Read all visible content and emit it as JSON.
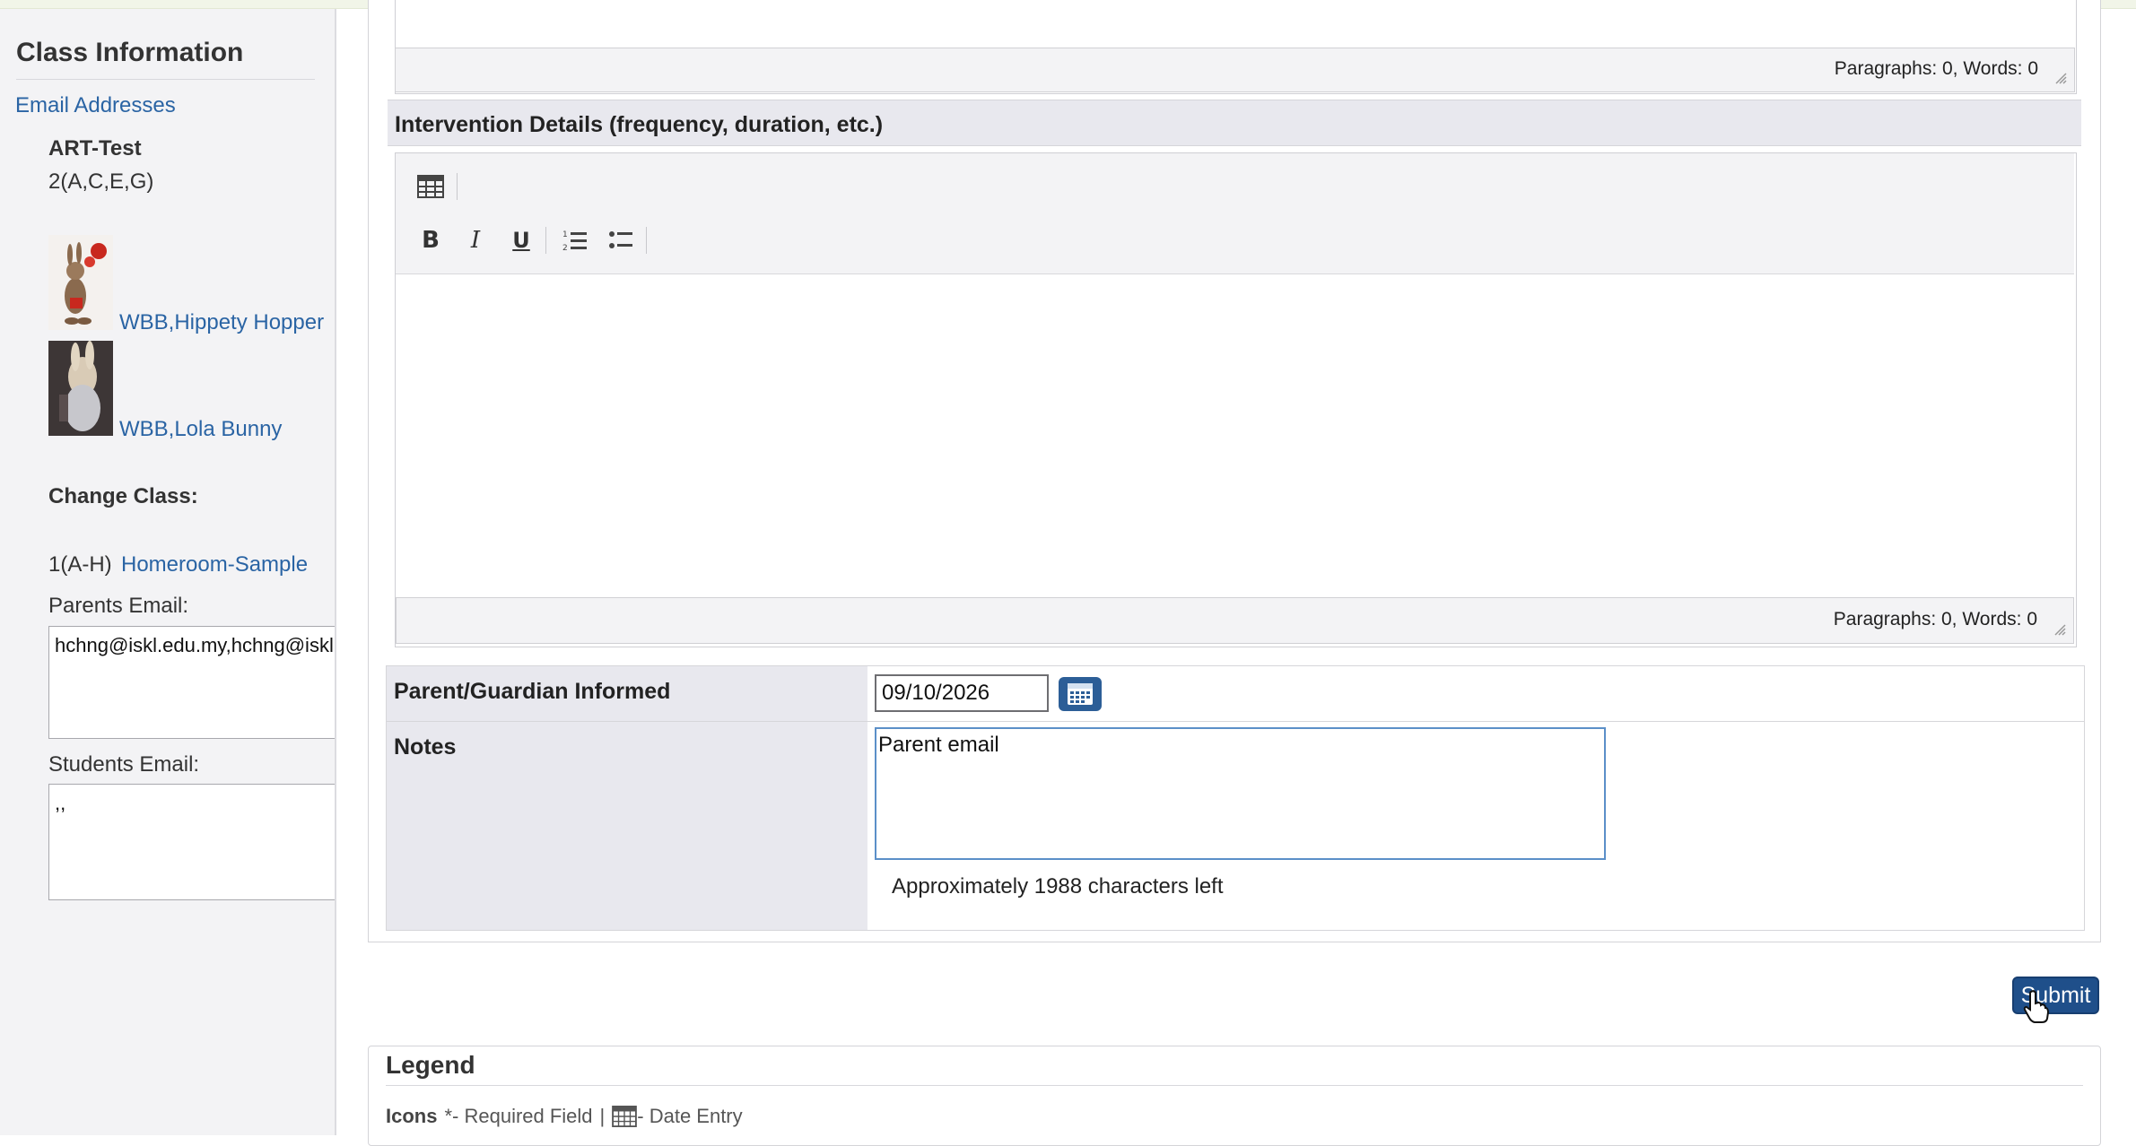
{
  "sidebar": {
    "title": "Class Information",
    "email_link": "Email Addresses",
    "class_name": "ART-Test",
    "class_period": "2(A,C,E,G)",
    "students": [
      {
        "name": "WBB,Hippety Hopper"
      },
      {
        "name": "WBB,Lola Bunny"
      }
    ],
    "change_class_label": "Change Class:",
    "other_class_period": "1(A-H)",
    "other_class_name": "Homeroom-Sample",
    "parents_email_label": "Parents Email:",
    "parents_email_value": "hchng@iskl.edu.my,hchng@iskl.edu.my,,,",
    "students_email_label": "Students Email:",
    "students_email_value": ",,"
  },
  "editor_top": {
    "status": "Paragraphs: 0, Words: 0"
  },
  "intervention": {
    "header": "Intervention Details (frequency, duration, etc.)",
    "status": "Paragraphs: 0, Words: 0",
    "toolbar": {
      "table_icon": "table-icon",
      "bold": "B",
      "italic": "I",
      "underline": "U",
      "ordered_list_icon": "ordered-list-icon",
      "bullet_list_icon": "bullet-list-icon"
    }
  },
  "form": {
    "parent_informed_label": "Parent/Guardian Informed",
    "parent_informed_date": "09/10/2026",
    "notes_label": "Notes",
    "notes_value": "Parent email",
    "chars_left": "Approximately 1988 characters left"
  },
  "submit_label": "Submit",
  "legend": {
    "title": "Legend",
    "icons_label": "Icons",
    "required": "*- Required Field",
    "separator": "|",
    "date_entry": "- Date Entry"
  },
  "colors": {
    "link": "#2a64a4",
    "button": "#1f4f8a",
    "header_bg": "#e8e8ee"
  }
}
